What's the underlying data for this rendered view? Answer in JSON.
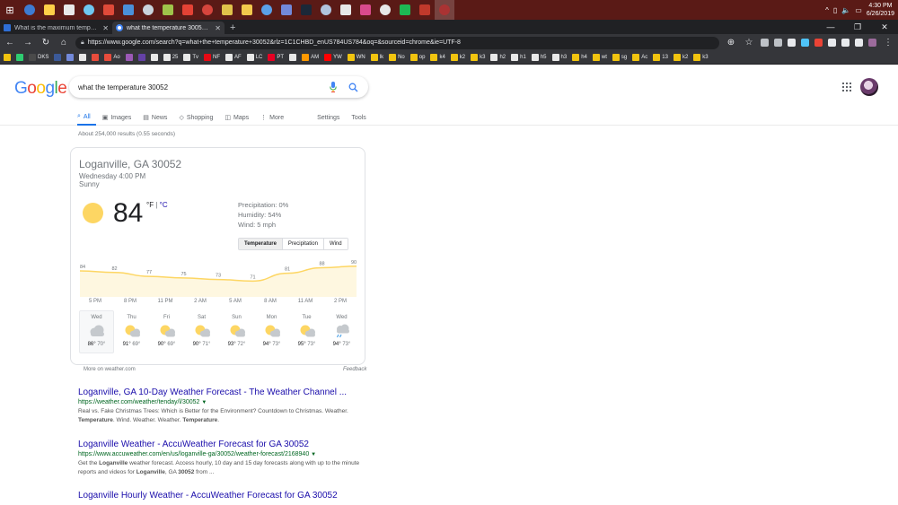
{
  "taskbar": {
    "icons": [
      "#3e7bd1",
      "#ffcf48",
      "#e8e8e8",
      "#6ec7f0",
      "#e04a39",
      "#4a90d9",
      "#c9d3dc",
      "#9fc34a",
      "#e44235",
      "#d6453d",
      "#e0c24a",
      "#f2c94c",
      "#5aa0e8",
      "#7289da",
      "#1b2838",
      "#b0c4de",
      "#e8e8e8",
      "#d94a8c",
      "#e8e8e8",
      "#1db954",
      "#c0392b",
      "#aa3333"
    ],
    "tray_icons": [
      "^",
      "▯",
      "🔈",
      "▭"
    ],
    "time": "4:30 PM",
    "date": "6/26/2019"
  },
  "tabs": [
    {
      "title": "What is the maximum temperatu",
      "favicon_color": "#2e6fd6",
      "active": false
    },
    {
      "title": "what the temperature 30052 - G",
      "favicon_color": "#4285f4",
      "active": true
    }
  ],
  "toolbar": {
    "url": "https://www.google.com/search?q=what+the+temperature+30052&rlz=1C1CHBD_enUS784US784&oq=&sourceid=chrome&ie=UTF-8",
    "ext_colors": [
      "#bdc1c6",
      "#bdc1c6",
      "#e8eaed",
      "#4fc3f7",
      "#ea4335",
      "#e8eaed",
      "#e8eaed",
      "#e8eaed",
      "#9c6b9c"
    ]
  },
  "bookmarks": [
    {
      "label": "",
      "color": "#f1c40f"
    },
    {
      "label": "",
      "color": "#2ecc71"
    },
    {
      "label": "DKS",
      "color": "#4a4a4a"
    },
    {
      "label": "",
      "color": "#3b5998"
    },
    {
      "label": "",
      "color": "#7289da"
    },
    {
      "label": "",
      "color": "#e8e8e8"
    },
    {
      "label": "",
      "color": "#e74c3c"
    },
    {
      "label": "Ao",
      "color": "#e74c3c"
    },
    {
      "label": "",
      "color": "#9b59b6"
    },
    {
      "label": "",
      "color": "#6441a5"
    },
    {
      "label": "",
      "color": "#e8e8e8"
    },
    {
      "label": "25",
      "color": "#e8e8e8"
    },
    {
      "label": "Tv",
      "color": "#e8e8e8"
    },
    {
      "label": "NF",
      "color": "#e50914"
    },
    {
      "label": "AF",
      "color": "#e8e8e8"
    },
    {
      "label": "LC",
      "color": "#e8e8e8"
    },
    {
      "label": "PT",
      "color": "#e60023"
    },
    {
      "label": "",
      "color": "#e8e8e8"
    },
    {
      "label": "AM",
      "color": "#ff9900"
    },
    {
      "label": "YW",
      "color": "#ff0000"
    },
    {
      "label": "WN",
      "color": "#f1c40f"
    },
    {
      "label": "lk",
      "color": "#f1c40f"
    },
    {
      "label": "No",
      "color": "#f1c40f"
    },
    {
      "label": "op",
      "color": "#f1c40f"
    },
    {
      "label": "k4",
      "color": "#f1c40f"
    },
    {
      "label": "k2",
      "color": "#f1c40f"
    },
    {
      "label": "k3",
      "color": "#f1c40f"
    },
    {
      "label": "h2",
      "color": "#e8e8e8"
    },
    {
      "label": "h1",
      "color": "#e8e8e8"
    },
    {
      "label": "h5",
      "color": "#e8e8e8"
    },
    {
      "label": "h3",
      "color": "#e8e8e8"
    },
    {
      "label": "h4",
      "color": "#f1c40f"
    },
    {
      "label": "wt",
      "color": "#f1c40f"
    },
    {
      "label": "sg",
      "color": "#f1c40f"
    },
    {
      "label": "Ac",
      "color": "#f1c40f"
    },
    {
      "label": "13",
      "color": "#f1c40f"
    },
    {
      "label": "k2",
      "color": "#f1c40f"
    },
    {
      "label": "k3",
      "color": "#f1c40f"
    }
  ],
  "google": {
    "logo_letters": [
      {
        "ch": "G",
        "color": "#4285f4"
      },
      {
        "ch": "o",
        "color": "#ea4335"
      },
      {
        "ch": "o",
        "color": "#fbbc05"
      },
      {
        "ch": "g",
        "color": "#4285f4"
      },
      {
        "ch": "l",
        "color": "#34a853"
      },
      {
        "ch": "e",
        "color": "#ea4335"
      }
    ],
    "query": "what the temperature 30052",
    "tabs": [
      {
        "label": "All",
        "icon": "search-icon",
        "active": true
      },
      {
        "label": "Images",
        "icon": "image-icon"
      },
      {
        "label": "News",
        "icon": "news-icon"
      },
      {
        "label": "Shopping",
        "icon": "tag-icon"
      },
      {
        "label": "Maps",
        "icon": "map-icon"
      },
      {
        "label": "More",
        "icon": "more-vert-icon"
      },
      {
        "label": "Settings"
      },
      {
        "label": "Tools"
      }
    ],
    "stats": "About 254,000 results (0.55 seconds)"
  },
  "weather": {
    "location": "Loganville, GA 30052",
    "time": "Wednesday 4:00 PM",
    "condition": "Sunny",
    "temp": "84",
    "unit_f": "°F",
    "unit_sep": " | ",
    "unit_c": "°C",
    "precipitation": "Precipitation: 0%",
    "humidity": "Humidity: 54%",
    "wind": "Wind: 5 mph",
    "buttons": [
      "Temperature",
      "Precipitation",
      "Wind"
    ],
    "chart_data": {
      "type": "area",
      "values": [
        84,
        82,
        77,
        75,
        73,
        71,
        81,
        88,
        90
      ],
      "value_labels": [
        "84",
        "82",
        "77",
        "75",
        "73",
        "71",
        "81",
        "88",
        "90"
      ],
      "x": [
        "5 PM",
        "8 PM",
        "11 PM",
        "2 AM",
        "5 AM",
        "8 AM",
        "11 AM",
        "2 PM"
      ],
      "color": "#fdd663",
      "fill": "#fef7e0"
    },
    "days": [
      {
        "name": "Wed",
        "hi": "86°",
        "lo": "70°",
        "icon": "cloud",
        "selected": true
      },
      {
        "name": "Thu",
        "hi": "91°",
        "lo": "69°",
        "icon": "partly-sunny"
      },
      {
        "name": "Fri",
        "hi": "90°",
        "lo": "69°",
        "icon": "partly-sunny"
      },
      {
        "name": "Sat",
        "hi": "90°",
        "lo": "71°",
        "icon": "partly-sunny"
      },
      {
        "name": "Sun",
        "hi": "93°",
        "lo": "72°",
        "icon": "partly-sunny"
      },
      {
        "name": "Mon",
        "hi": "94°",
        "lo": "73°",
        "icon": "partly-sunny"
      },
      {
        "name": "Tue",
        "hi": "95°",
        "lo": "73°",
        "icon": "partly-sunny"
      },
      {
        "name": "Wed",
        "hi": "94°",
        "lo": "73°",
        "icon": "rain"
      }
    ],
    "footer_left": "More on weather.com",
    "footer_right": "Feedback"
  },
  "results": [
    {
      "title": "Loganville, GA 10-Day Weather Forecast - The Weather Channel ...",
      "url": "https://weather.com/weather/tenday/l/30052",
      "snippet_html": "Real vs. Fake Christmas Trees: Which is Better for the Environment? Countdown to Christmas. Weather. <b>Temperature</b>. Wind. Weather. Weather. <b>Temperature</b>."
    },
    {
      "title": "Loganville Weather - AccuWeather Forecast for GA 30052",
      "url": "https://www.accuweather.com/en/us/loganville-ga/30052/weather-forecast/2168940",
      "snippet_html": "Get the <b>Loganville</b> weather forecast. Access hourly, 10 day and 15 day forecasts along with up to the minute reports and videos for <b>Loganville</b>, GA <b>30052</b> from ..."
    },
    {
      "title": "Loganville Hourly Weather - AccuWeather Forecast for GA 30052",
      "url": "",
      "snippet_html": ""
    }
  ]
}
